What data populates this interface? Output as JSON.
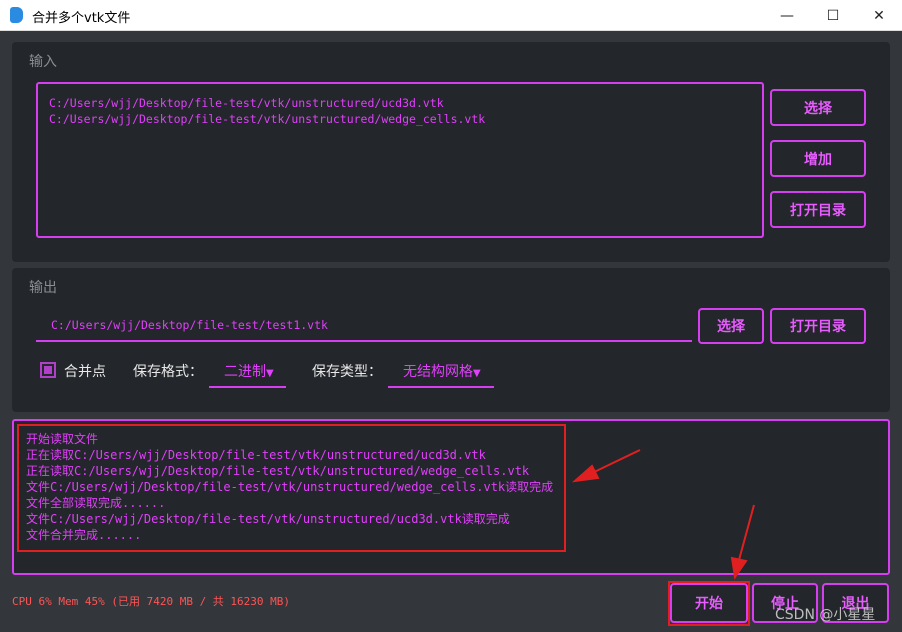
{
  "window": {
    "title": "合并多个vtk文件",
    "minimize": "—",
    "maximize": "☐",
    "close": "✕"
  },
  "input": {
    "label": "输入",
    "files": [
      "C:/Users/wjj/Desktop/file-test/vtk/unstructured/ucd3d.vtk",
      "C:/Users/wjj/Desktop/file-test/vtk/unstructured/wedge_cells.vtk"
    ],
    "select": "选择",
    "add": "增加",
    "open_dir": "打开目录"
  },
  "output": {
    "label": "输出",
    "path": "C:/Users/wjj/Desktop/file-test/test1.vtk",
    "select": "选择",
    "open_dir": "打开目录",
    "merge_points_label": "合并点",
    "merge_points_checked": true,
    "format_label": "保存格式：",
    "format_value": "二进制",
    "type_label": "保存类型：",
    "type_value": "无结构网格"
  },
  "log": [
    "开始读取文件",
    "正在读取C:/Users/wjj/Desktop/file-test/vtk/unstructured/ucd3d.vtk",
    "正在读取C:/Users/wjj/Desktop/file-test/vtk/unstructured/wedge_cells.vtk",
    "文件C:/Users/wjj/Desktop/file-test/vtk/unstructured/wedge_cells.vtk读取完成",
    "文件全部读取完成......",
    "文件C:/Users/wjj/Desktop/file-test/vtk/unstructured/ucd3d.vtk读取完成",
    "文件合并完成......"
  ],
  "status": "CPU 6% Mem 45% (已用 7420 MB / 共 16230 MB)",
  "buttons": {
    "start": "开始",
    "stop": "停止",
    "exit": "退出"
  },
  "watermark": "CSDN @小星星",
  "colors": {
    "accent": "#e040fb",
    "annotation": "#e02020"
  }
}
